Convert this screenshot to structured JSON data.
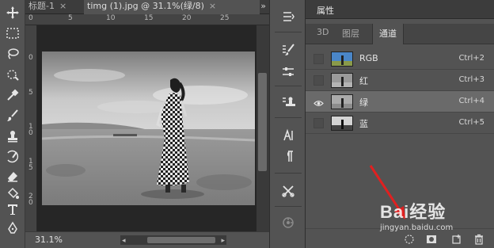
{
  "document_tabs": [
    {
      "title": "标题-1",
      "close": "×"
    },
    {
      "title": "timg (1).jpg @ 31.1%(绿/8)",
      "close": "×"
    }
  ],
  "tabs_more": "»",
  "ruler_top_labels": [
    "0",
    "5",
    "10",
    "15",
    "20",
    "25"
  ],
  "ruler_left_labels": [
    "0",
    "5",
    "1 0",
    "1 5",
    "2 0"
  ],
  "status": {
    "zoom": "31.1%"
  },
  "panel": {
    "header": "属性",
    "tabs": [
      "3D",
      "图层",
      "通道"
    ],
    "active_tab": "通道",
    "channels": [
      {
        "name": "RGB",
        "shortcut": "Ctrl+2",
        "visible": false,
        "selected": false
      },
      {
        "name": "红",
        "shortcut": "Ctrl+3",
        "visible": false,
        "selected": false
      },
      {
        "name": "绿",
        "shortcut": "Ctrl+4",
        "visible": true,
        "selected": true
      },
      {
        "name": "蓝",
        "shortcut": "Ctrl+5",
        "visible": false,
        "selected": false
      }
    ]
  },
  "watermark": {
    "brand": "Bai经验",
    "url": "jingyan.baidu.com"
  },
  "colors": {
    "toolbar": "#535353",
    "panel": "#535353",
    "selected_row": "#6a6a6a",
    "arrow": "#e02020"
  }
}
